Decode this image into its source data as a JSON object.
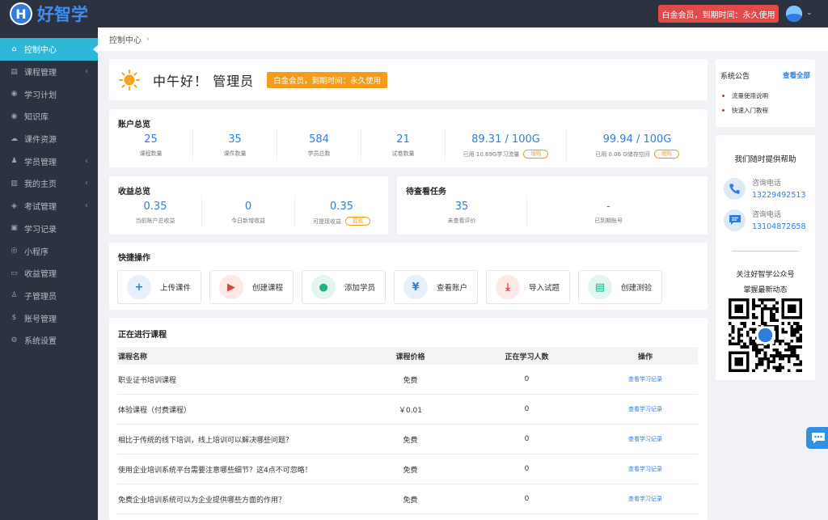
{
  "app": {
    "name": "好智学",
    "logo_letter": "H"
  },
  "topbar": {
    "member_badge": "白金会员，到期时间：永久使用",
    "caret": "⌄"
  },
  "sidebar": {
    "items": [
      {
        "label": "控制中心",
        "icon": "home-icon",
        "glyph": "⌂",
        "active": true,
        "arrow": false
      },
      {
        "label": "课程管理",
        "icon": "book-icon",
        "glyph": "▤",
        "active": false,
        "arrow": true
      },
      {
        "label": "学习计划",
        "icon": "eye-icon",
        "glyph": "◉",
        "active": false,
        "arrow": false
      },
      {
        "label": "知识库",
        "icon": "eye-icon",
        "glyph": "◉",
        "active": false,
        "arrow": false
      },
      {
        "label": "课件资源",
        "icon": "cloud-icon",
        "glyph": "☁",
        "active": false,
        "arrow": false
      },
      {
        "label": "学员管理",
        "icon": "users-icon",
        "glyph": "♟",
        "active": false,
        "arrow": true
      },
      {
        "label": "我的主页",
        "icon": "page-icon",
        "glyph": "▥",
        "active": false,
        "arrow": true
      },
      {
        "label": "考试管理",
        "icon": "tag-icon",
        "glyph": "◈",
        "active": false,
        "arrow": true
      },
      {
        "label": "学习记录",
        "icon": "card-icon",
        "glyph": "▣",
        "active": false,
        "arrow": false
      },
      {
        "label": "小程序",
        "icon": "wechat-icon",
        "glyph": "◎",
        "active": false,
        "arrow": false
      },
      {
        "label": "收益管理",
        "icon": "wallet-icon",
        "glyph": "▭",
        "active": false,
        "arrow": false
      },
      {
        "label": "子管理员",
        "icon": "user-icon",
        "glyph": "♙",
        "active": false,
        "arrow": false
      },
      {
        "label": "账号管理",
        "icon": "dollar-icon",
        "glyph": "$",
        "active": false,
        "arrow": false
      },
      {
        "label": "系统设置",
        "icon": "gear-icon",
        "glyph": "⚙",
        "active": false,
        "arrow": false
      }
    ]
  },
  "breadcrumb": {
    "current": "控制中心",
    "sep": "›"
  },
  "greeting": {
    "title": "中午好！ 管理员",
    "badge": "白金会员，到期时间：永久使用"
  },
  "account": {
    "title": "账户总览",
    "stats": [
      {
        "value": "25",
        "label": "课程数量"
      },
      {
        "value": "35",
        "label": "课件数量"
      },
      {
        "value": "584",
        "label": "学员总数"
      },
      {
        "value": "21",
        "label": "试卷数量"
      },
      {
        "value": "89.31 / 100G",
        "label": "已用 10.69G学习流量",
        "button": "增购"
      },
      {
        "value": "99.94 / 100G",
        "label": "已用 0.06 G储存空间",
        "button": "增购"
      }
    ]
  },
  "income": {
    "title": "收益总览",
    "stats": [
      {
        "value": "0.35",
        "label": "当前账户总收益"
      },
      {
        "value": "0",
        "label": "今日新增收益"
      },
      {
        "value": "0.35",
        "label": "可提现收益",
        "button": "提现"
      }
    ]
  },
  "pending": {
    "title": "待查看任务",
    "stats": [
      {
        "value": "35",
        "label": "未查看评价"
      },
      {
        "value": "-",
        "label": "已到期账号"
      }
    ]
  },
  "quick": {
    "title": "快捷操作",
    "actions": [
      {
        "label": "上传课件",
        "icon": "plus-icon",
        "glyph": "+",
        "bg": "#e6effb",
        "fg": "#2f7de1"
      },
      {
        "label": "创建课程",
        "icon": "video-icon",
        "glyph": "▶",
        "bg": "#fde8e6",
        "fg": "#e0452f"
      },
      {
        "label": "添加学员",
        "icon": "user-add-icon",
        "glyph": "●",
        "bg": "#e3f5ef",
        "fg": "#1bb38a"
      },
      {
        "label": "查看账户",
        "icon": "yen-icon",
        "glyph": "¥",
        "bg": "#e6effb",
        "fg": "#2f7de1"
      },
      {
        "label": "导入试题",
        "icon": "download-icon",
        "glyph": "⤓",
        "bg": "#fdeae6",
        "fg": "#e0452f"
      },
      {
        "label": "创建测验",
        "icon": "document-icon",
        "glyph": "▤",
        "bg": "#e3f5ef",
        "fg": "#1bb38a"
      }
    ]
  },
  "courses": {
    "title": "正在进行课程",
    "headers": [
      "课程名称",
      "课程价格",
      "正在学习人数",
      "操作"
    ],
    "rows": [
      {
        "name": "职业证书培训课程",
        "price": "免费",
        "learners": "0",
        "action": "查看学习记录"
      },
      {
        "name": "体验课程（付费课程）",
        "price": "￥0.01",
        "learners": "0",
        "action": "查看学习记录"
      },
      {
        "name": "相比于传统的线下培训，线上培训可以解决哪些问题？",
        "price": "免费",
        "learners": "0",
        "action": "查看学习记录"
      },
      {
        "name": "使用企业培训系统平台需要注意哪些细节？这4点不可忽略！",
        "price": "免费",
        "learners": "0",
        "action": "查看学习记录"
      },
      {
        "name": "免费企业培训系统可以为企业提供哪些方面的作用？",
        "price": "免费",
        "learners": "0",
        "action": "查看学习记录"
      }
    ]
  },
  "notice": {
    "title": "系统公告",
    "view_all": "查看全部",
    "items": [
      "流量使用说明",
      "快速入门教程"
    ]
  },
  "help": {
    "title": "我们随时提供帮助",
    "contacts": [
      {
        "label": "咨询电话",
        "value": "13229492513",
        "icon": "phone-icon"
      },
      {
        "label": "咨询电话",
        "value": "13104872658",
        "icon": "chat-icon"
      }
    ],
    "follow_line1": "关注好智学公众号",
    "follow_line2": "掌握最新动态"
  },
  "colors": {
    "sidebar": "#2d3241",
    "active": "#2fb7d8",
    "accent": "#2f7de1",
    "orange": "#f39c1a",
    "red": "#e24a4a"
  }
}
